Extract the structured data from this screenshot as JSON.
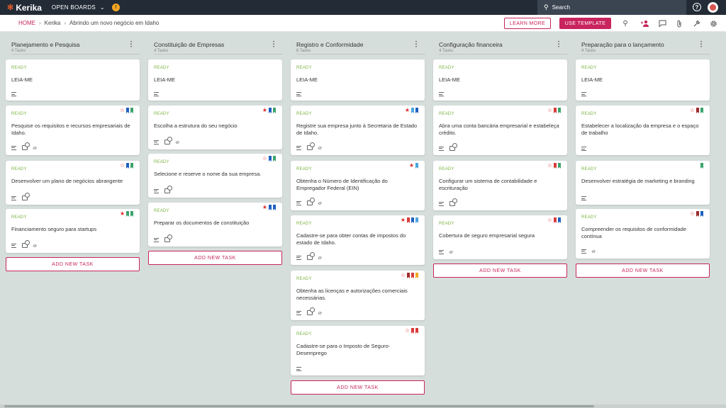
{
  "app": {
    "logo": "Kerika",
    "open_boards": "OPEN BOARDS",
    "org_badge": "!",
    "search_placeholder": "Search",
    "help": "?"
  },
  "breadcrumb": {
    "home": "HOME",
    "org": "Kerika",
    "board": "Abrindo um novo negócio em Idaho"
  },
  "toolbar": {
    "learn_more": "LEARN MORE",
    "use_template": "USE TEMPLATE"
  },
  "colors": {
    "accent": "#c8245e",
    "ready": "#7cb342",
    "blue": "#1e5fbf",
    "green": "#3aa36b",
    "red": "#d93a3a",
    "darkred": "#9c2b2b",
    "sky": "#4aa3df",
    "orange": "#f5a623"
  },
  "add_task_label": "ADD NEW TASK",
  "columns": [
    {
      "title": "Planejamento e Pesquisa",
      "count": "4 Tasks",
      "cards": [
        {
          "status": "READY",
          "title": "LEIA-ME",
          "star": "",
          "flags": [],
          "check": false,
          "clip": false
        },
        {
          "status": "READY",
          "title": "Pesquise os requisitos e recursos empresariais de Idaho.",
          "star": "empty",
          "flags": [
            "blue",
            "green"
          ],
          "check": true,
          "clip": true
        },
        {
          "status": "READY",
          "title": "Desenvolver um plano de negócios abrangente",
          "star": "empty",
          "flags": [
            "blue",
            "green"
          ],
          "check": true,
          "clip": false
        },
        {
          "status": "READY",
          "title": "Financiamento seguro para startups",
          "star": "filled",
          "flags": [
            "green",
            "green"
          ],
          "check": true,
          "clip": true
        }
      ]
    },
    {
      "title": "Constituição de Empresas",
      "count": "4 Tasks",
      "cards": [
        {
          "status": "READY",
          "title": "LEIA-ME",
          "star": "",
          "flags": [],
          "check": false,
          "clip": false
        },
        {
          "status": "READY",
          "title": "Escolha a estrutura do seu negócio",
          "star": "filled",
          "flags": [
            "blue",
            "green"
          ],
          "check": true,
          "clip": true
        },
        {
          "status": "READY",
          "title": "Selecione e reserve o nome da sua empresa.",
          "star": "empty",
          "flags": [
            "blue",
            "green"
          ],
          "check": true,
          "clip": false
        },
        {
          "status": "READY",
          "title": "Preparar os documentos de constituição",
          "star": "filled",
          "flags": [
            "blue",
            "blue"
          ],
          "check": true,
          "clip": false
        }
      ]
    },
    {
      "title": "Registro e Conformidade",
      "count": "6 Tasks",
      "cards": [
        {
          "status": "READY",
          "title": "LEIA-ME",
          "star": "",
          "flags": [],
          "check": false,
          "clip": false
        },
        {
          "status": "READY",
          "title": "Registre sua empresa junto à Secretaria de Estado de Idaho.",
          "star": "filled",
          "flags": [
            "sky",
            "blue"
          ],
          "check": true,
          "clip": true
        },
        {
          "status": "READY",
          "title": "Obtenha o Número de Identificação do Empregador Federal (EIN)",
          "star": "filled",
          "flags": [
            "sky"
          ],
          "check": true,
          "clip": true
        },
        {
          "status": "READY",
          "title": "Cadastre-se para obter contas de impostos do estado de Idaho.",
          "star": "filled",
          "flags": [
            "red",
            "blue",
            "sky"
          ],
          "check": true,
          "clip": true
        },
        {
          "status": "READY",
          "title": "Obtenha as licenças e autorizações comerciais necessárias.",
          "star": "empty",
          "flags": [
            "darkred",
            "red",
            "orange"
          ],
          "check": true,
          "clip": true
        },
        {
          "status": "READY",
          "title": "Cadastre-se para o Imposto de Seguro-Desemprego",
          "star": "empty",
          "flags": [
            "red",
            "red"
          ],
          "check": false,
          "clip": false
        }
      ]
    },
    {
      "title": "Configuração financeira",
      "count": "4 Tasks",
      "cards": [
        {
          "status": "READY",
          "title": "LEIA-ME",
          "star": "",
          "flags": [],
          "check": false,
          "clip": false
        },
        {
          "status": "READY",
          "title": "Abra uma conta bancária empresarial e estabeleça crédito.",
          "star": "empty",
          "flags": [
            "red",
            "green"
          ],
          "check": true,
          "clip": false
        },
        {
          "status": "READY",
          "title": "Configurar um sistema de contabilidade e escrituração",
          "star": "empty",
          "flags": [
            "red",
            "green"
          ],
          "check": true,
          "clip": false
        },
        {
          "status": "READY",
          "title": "Cobertura de seguro empresarial segura",
          "star": "empty",
          "flags": [
            "red",
            "blue"
          ],
          "check": false,
          "clip": true
        }
      ]
    },
    {
      "title": "Preparação para o lançamento",
      "count": "4 Tasks",
      "cards": [
        {
          "status": "READY",
          "title": "LEIA-ME",
          "star": "",
          "flags": [],
          "check": false,
          "clip": false
        },
        {
          "status": "READY",
          "title": "Estabelecer a localização da empresa e o espaço de trabalho",
          "star": "empty",
          "flags": [
            "darkred",
            "green"
          ],
          "check": false,
          "clip": false
        },
        {
          "status": "READY",
          "title": "Desenvolver estratégia de marketing e branding",
          "star": "",
          "flags": [
            "green"
          ],
          "check": false,
          "clip": false
        },
        {
          "status": "READY",
          "title": "Compreender os requisitos de conformidade contínua",
          "star": "empty",
          "flags": [
            "darkred",
            "blue"
          ],
          "check": false,
          "clip": true
        }
      ]
    }
  ]
}
